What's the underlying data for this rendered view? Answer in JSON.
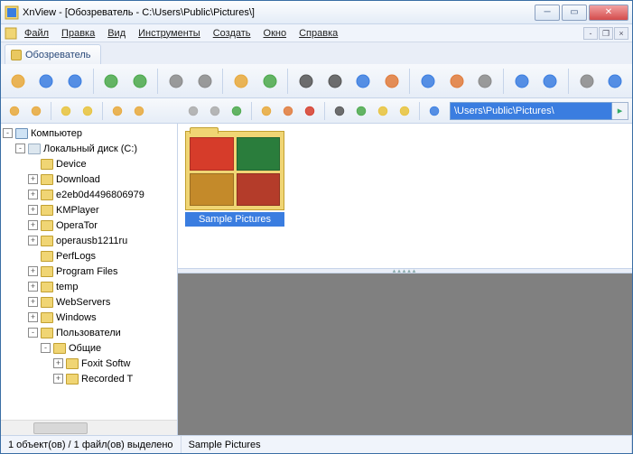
{
  "window": {
    "title": "XnView - [Обозреватель - C:\\Users\\Public\\Pictures\\]"
  },
  "menu": {
    "file": "Файл",
    "edit": "Правка",
    "view": "Вид",
    "tools": "Инструменты",
    "create": "Создать",
    "window": "Окно",
    "help": "Справка"
  },
  "tab": {
    "label": "Обозреватель"
  },
  "address": {
    "path": "\\Users\\Public\\Pictures\\"
  },
  "tree": {
    "root": "Компьютер",
    "drive": "Локальный диск (C:)",
    "nodes": [
      "Device",
      "Download",
      "e2eb0d4496806979",
      "KMPlayer",
      "OperaTor",
      "operausb1211ru",
      "PerfLogs",
      "Program Files",
      "temp",
      "WebServers",
      "Windows"
    ],
    "users": "Пользователи",
    "public": "Общие",
    "sub": [
      "Foxit Softw",
      "Recorded T"
    ]
  },
  "thumb": {
    "caption": "Sample Pictures"
  },
  "status": {
    "cell1": "1 объект(ов) / 1 файл(ов) выделено",
    "cell2": "Sample Pictures"
  },
  "toolbar_icons": [
    "open-icon",
    "fullscreen-icon",
    "slideshow-icon",
    "sep",
    "refresh-icon",
    "refresh2-icon",
    "sep",
    "copy-icon",
    "options-icon",
    "sep",
    "home-icon",
    "up-icon",
    "sep",
    "search-icon",
    "print-icon",
    "scan-icon",
    "contact-icon",
    "sep",
    "capture-icon",
    "hex-icon",
    "compare-icon",
    "sep",
    "batch-icon",
    "batch2-icon",
    "sep",
    "settings-icon",
    "about-icon"
  ],
  "sidebar_icons": [
    "tree-icon",
    "tree2-icon",
    "sep2",
    "fav-icon",
    "favadd-icon",
    "sep2",
    "cat-icon",
    "catadd-icon"
  ],
  "nav_icons": [
    "back-icon",
    "forward-icon",
    "up-icon",
    "sep",
    "newfolder-icon",
    "rename-icon",
    "delete-icon",
    "sep",
    "view-icon",
    "sort-icon",
    "filter-icon",
    "filter2-icon",
    "sep",
    "star-icon"
  ],
  "colors": {
    "thumb_cells": [
      "#d63c2a",
      "#2a7d3c",
      "#c48a2a",
      "#b43c2a"
    ]
  }
}
